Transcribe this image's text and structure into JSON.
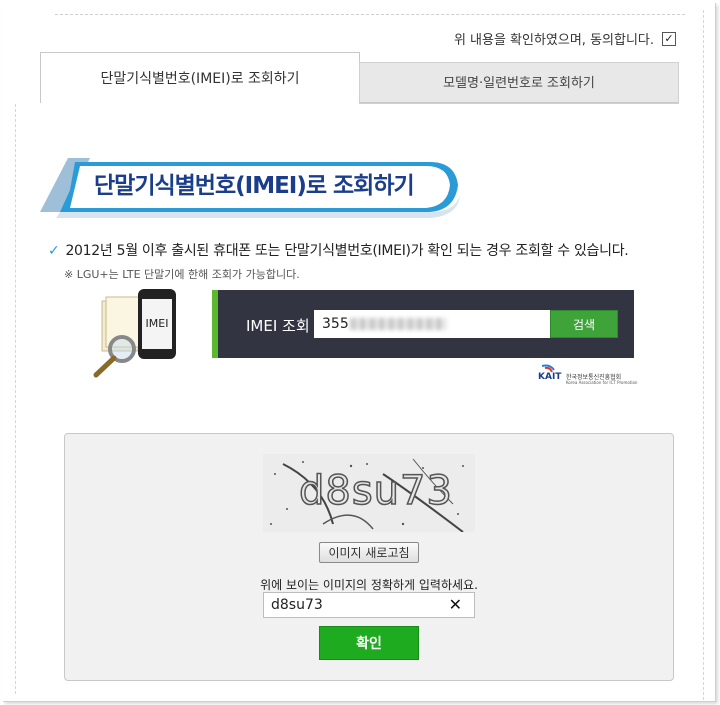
{
  "agreement": {
    "label": "위 내용을 확인하였으며, 동의합니다.",
    "checked": true
  },
  "tabs": [
    {
      "label": "단말기식별번호(IMEI)로 조회하기",
      "active": true
    },
    {
      "label": "모델명·일련번호로 조회하기",
      "active": false
    }
  ],
  "section": {
    "banner_title": "단말기식별번호(IMEI)로 조회하기",
    "notice": "2012년 5월 이후 출시된 휴대폰 또는 단말기식별번호(IMEI)가 확인 되는 경우 조회할 수 있습니다.",
    "subnote": "※ LGU+는 LTE 단말기에 한해 조회가 가능합니다."
  },
  "illustration": {
    "phone_text": "IMEI"
  },
  "imei_search": {
    "label": "IMEI 조회",
    "value": "355",
    "button": "검색"
  },
  "kait": {
    "logo": "KAIT",
    "org_kr": "한국정보통신진흥협회",
    "org_en": "Korea Association for ICT Promotion"
  },
  "captcha": {
    "image_text": "d8su73",
    "refresh_button": "이미지 새로고침",
    "instruction": "위에 보이는 이미지의 정확하게 입력하세요.",
    "input_value": "d8su73",
    "clear_icon": "✕",
    "confirm_button": "확인"
  },
  "colors": {
    "accent_green": "#1fab1f",
    "bar_dark": "#323541",
    "banner_blue": "#2b9bd8",
    "title_navy": "#1b3e8c"
  }
}
